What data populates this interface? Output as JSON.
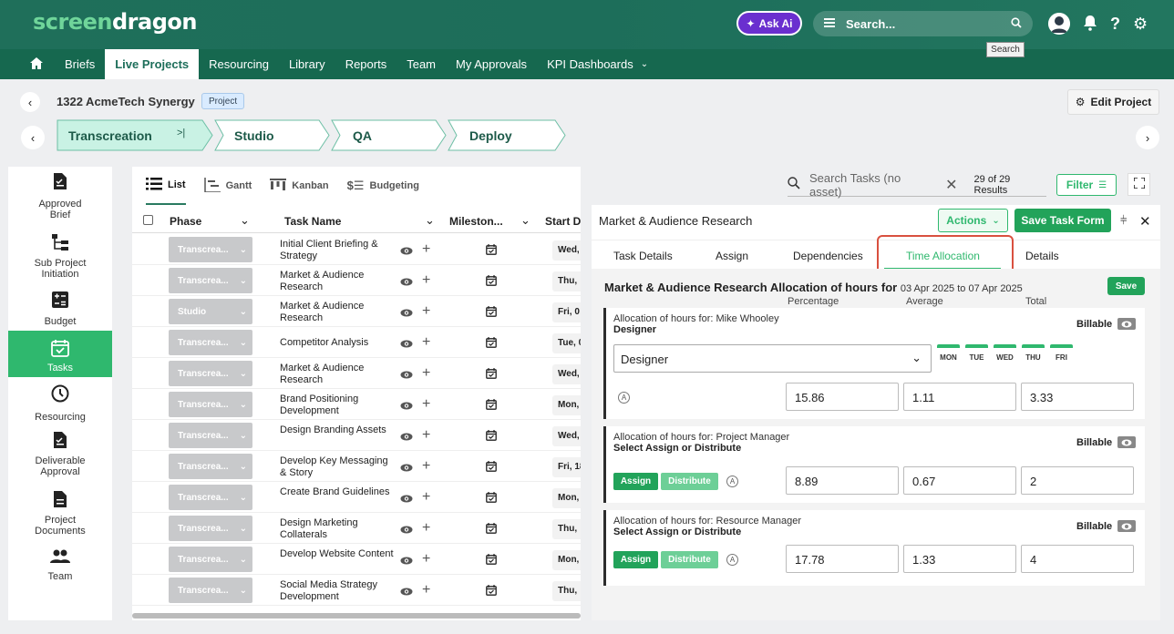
{
  "header": {
    "logo_part1": "screen",
    "logo_part2": "dragon",
    "ask_ai": "Ask Ai",
    "search_placeholder": "Search...",
    "search_tooltip": "Search"
  },
  "nav": {
    "items": [
      "Briefs",
      "Live Projects",
      "Resourcing",
      "Library",
      "Reports",
      "Team",
      "My Approvals",
      "KPI Dashboards"
    ],
    "active": "Live Projects"
  },
  "project": {
    "title": "1322 AcmeTech Synergy",
    "badge": "Project",
    "edit_label": "Edit Project"
  },
  "stages": [
    "Transcreation",
    "Studio",
    "QA",
    "Deploy"
  ],
  "sidebar": {
    "items": [
      "Approved Brief",
      "Sub Project Initiation",
      "Budget",
      "Tasks",
      "Resourcing",
      "Deliverable Approval",
      "Project Documents",
      "Team"
    ]
  },
  "views": [
    "List",
    "Gantt",
    "Kanban",
    "Budgeting"
  ],
  "table": {
    "columns": [
      "Phase",
      "Task Name",
      "Mileston...",
      "Start D"
    ],
    "rows": [
      {
        "phase": "Transcrea...",
        "task": "Initial Client Briefing & Strategy",
        "start": "Wed,"
      },
      {
        "phase": "Transcrea...",
        "task": "Market & Audience Research",
        "start": "Thu,"
      },
      {
        "phase": "Studio",
        "task": "Market & Audience Research",
        "start": "Fri, 0"
      },
      {
        "phase": "Transcrea...",
        "task": "Competitor Analysis",
        "start": "Tue, 0"
      },
      {
        "phase": "Transcrea...",
        "task": "Market & Audience Research",
        "start": "Wed,"
      },
      {
        "phase": "Transcrea...",
        "task": "Brand Positioning Development",
        "start": "Mon,"
      },
      {
        "phase": "Transcrea...",
        "task": "Design Branding Assets",
        "start": "Wed,"
      },
      {
        "phase": "Transcrea...",
        "task": "Develop Key Messaging & Story",
        "start": "Fri, 18"
      },
      {
        "phase": "Transcrea...",
        "task": "Create Brand Guidelines",
        "start": "Mon,"
      },
      {
        "phase": "Transcrea...",
        "task": "Design Marketing Collaterals",
        "start": "Thu,"
      },
      {
        "phase": "Transcrea...",
        "task": "Develop Website Content",
        "start": "Mon,"
      },
      {
        "phase": "Transcrea...",
        "task": "Social Media Strategy Development",
        "start": "Thu,"
      }
    ]
  },
  "task_search": {
    "placeholder": "Search Tasks (no asset)",
    "results": "29 of 29 Results",
    "filter": "Filter"
  },
  "detail": {
    "title": "Market & Audience Research",
    "actions": "Actions",
    "save_form": "Save Task Form",
    "tabs": [
      "Task Details",
      "Assign",
      "Dependencies",
      "Time Allocation",
      "Details"
    ],
    "active_tab": "Time Allocation",
    "heading": "Market & Audience Research Allocation of hours for",
    "dates": "03 Apr 2025 to 07 Apr 2025",
    "save": "Save",
    "col_headers": [
      "Percentage",
      "Average",
      "Total"
    ],
    "billable": "Billable",
    "assign": "Assign",
    "distribute": "Distribute",
    "days": [
      "MON",
      "TUE",
      "WED",
      "THU",
      "FRI"
    ],
    "allocations": [
      {
        "for": "Allocation of hours for: Mike Whooley",
        "sub": "Designer",
        "role": "Designer",
        "percentage": "15.86",
        "average": "1.11",
        "total": "3.33"
      },
      {
        "for": "Allocation of hours for: Project Manager",
        "sub": "Select Assign or Distribute",
        "percentage": "8.89",
        "average": "0.67",
        "total": "2"
      },
      {
        "for": "Allocation of hours for: Resource Manager",
        "sub": "Select Assign or Distribute",
        "percentage": "17.78",
        "average": "1.33",
        "total": "4"
      }
    ]
  }
}
